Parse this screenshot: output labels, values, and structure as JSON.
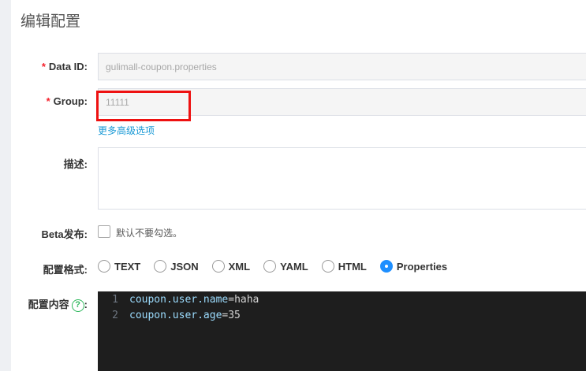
{
  "page": {
    "title": "编辑配置"
  },
  "form": {
    "data_id": {
      "label": "Data ID:",
      "required_mark": "*",
      "value": "gulimall-coupon.properties"
    },
    "group": {
      "label": "Group:",
      "required_mark": "*",
      "value": "11111"
    },
    "more_options_link": "更多高级选项",
    "description": {
      "label": "描述:",
      "value": ""
    },
    "beta": {
      "label": "Beta发布:",
      "hint": "默认不要勾选。",
      "checked": false
    },
    "format": {
      "label": "配置格式:",
      "options": [
        "TEXT",
        "JSON",
        "XML",
        "YAML",
        "HTML",
        "Properties"
      ],
      "selected": "Properties"
    },
    "content": {
      "label": "配置内容",
      "colon": ":",
      "help_icon": "question-circle-icon",
      "lines": [
        {
          "num": "1",
          "key": "coupon.user.name",
          "sep": "=",
          "value": "haha"
        },
        {
          "num": "2",
          "key": "coupon.user.age",
          "sep": "=",
          "value": "35"
        }
      ]
    }
  },
  "colors": {
    "accent": "#1e8fff",
    "link": "#1a9ad6",
    "required": "#f5222d",
    "highlight": "#ee1111",
    "editor_bg": "#1e1e1e"
  }
}
